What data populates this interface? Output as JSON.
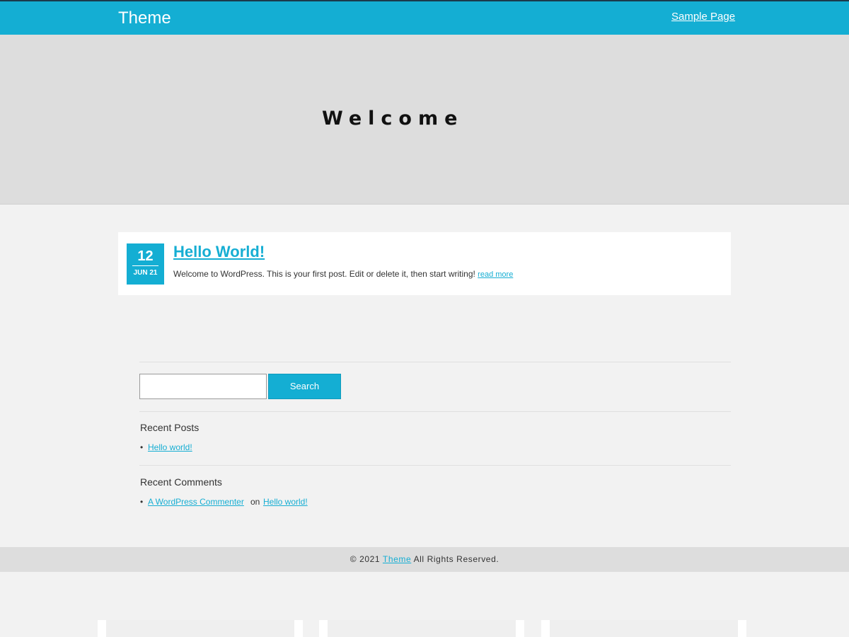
{
  "header": {
    "site_title": "Theme",
    "nav_link": "Sample Page"
  },
  "hero": {
    "title": "Welcome"
  },
  "post": {
    "day": "12",
    "month_year": "JUN 21",
    "title": "Hello World!",
    "excerpt": "Welcome to WordPress. This is your first post. Edit or delete it, then start writing!",
    "read_more": "read more"
  },
  "sidebar": {
    "search_value": "",
    "search_button": "Search",
    "recent_posts_title": "Recent Posts",
    "recent_posts": [
      "Hello world!"
    ],
    "recent_comments_title": "Recent Comments",
    "recent_comment": {
      "author": "A WordPress Commenter",
      "connector": "on",
      "post": "Hello world!"
    }
  },
  "footer": {
    "copyright_prefix": "© 2021",
    "site_link": "Theme",
    "suffix": "All Rights Reserved."
  },
  "colors": {
    "accent": "#14aed3",
    "hero_bg": "#dddddd",
    "page_bg": "#f2f2f2"
  }
}
